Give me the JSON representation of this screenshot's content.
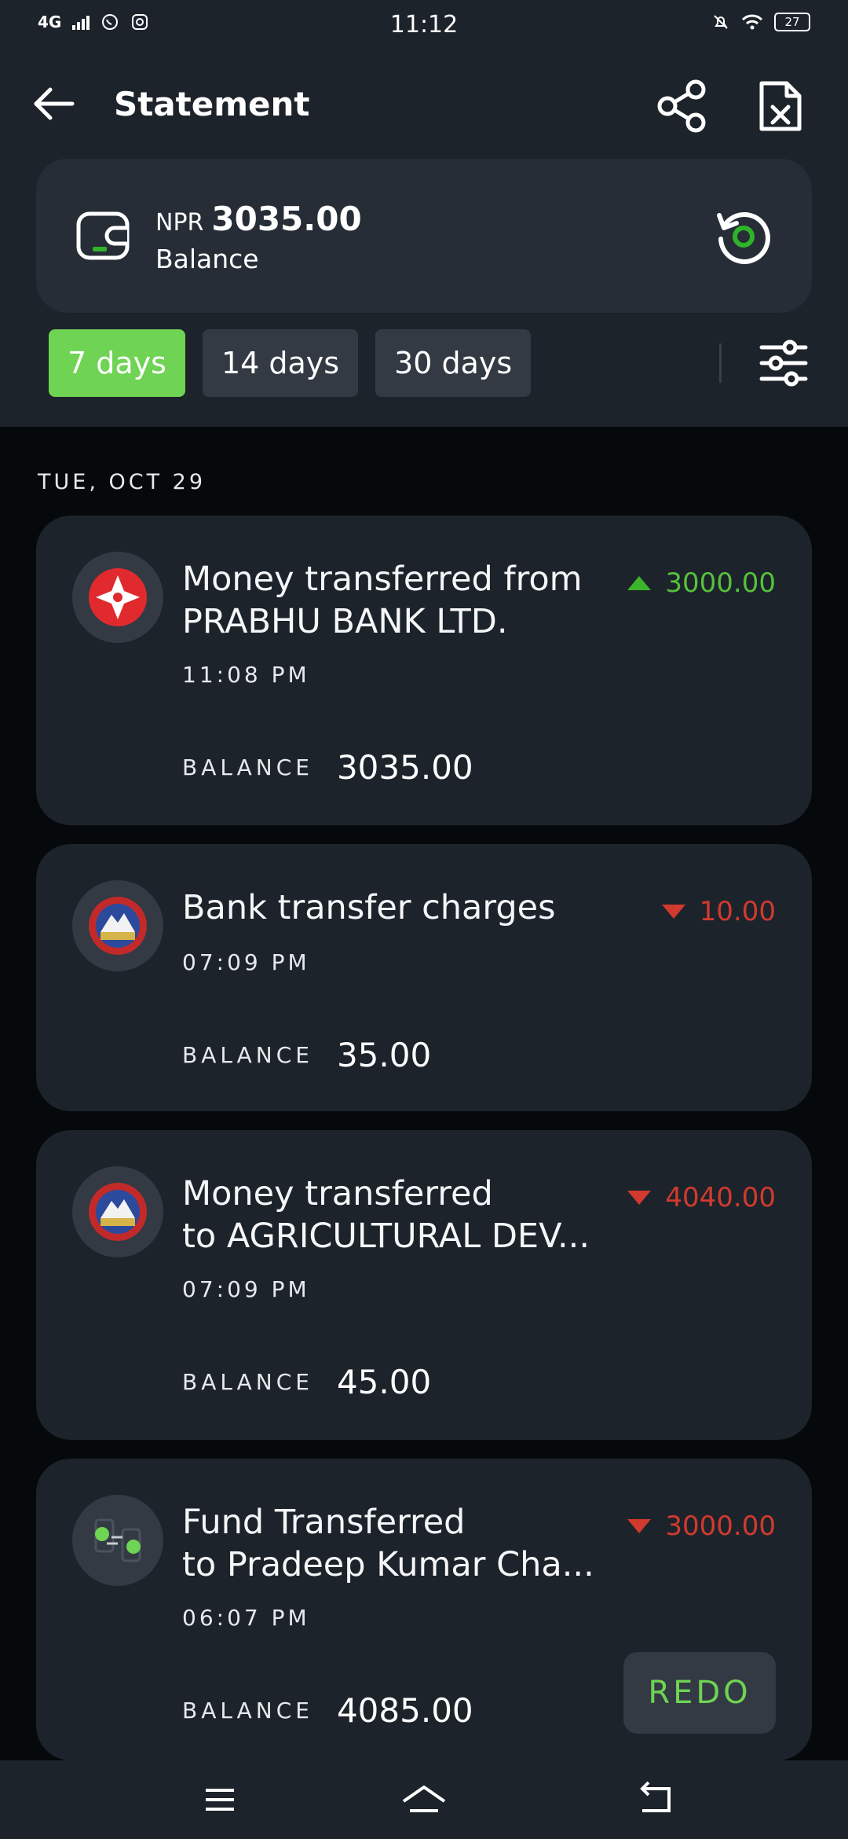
{
  "status_bar": {
    "network": "4G",
    "time": "11:12",
    "battery": "27"
  },
  "header": {
    "title": "Statement"
  },
  "balance": {
    "currency": "NPR",
    "amount": "3035.00",
    "label": "Balance"
  },
  "filters": [
    {
      "label": "7 days",
      "active": true
    },
    {
      "label": "14 days",
      "active": false
    },
    {
      "label": "30 days",
      "active": false
    }
  ],
  "date_header": "TUE, OCT 29",
  "transactions": [
    {
      "description_line1": "Money transferred from",
      "description_line2": "PRABHU BANK LTD.",
      "amount": "3000.00",
      "direction": "credit",
      "time": "11:08 PM",
      "balance_label": "BALANCE",
      "balance": "3035.00",
      "icon": "prabhu-bank-logo-icon"
    },
    {
      "description_line1": "Bank transfer charges",
      "description_line2": "",
      "amount": "10.00",
      "direction": "debit",
      "time": "07:09 PM",
      "balance_label": "BALANCE",
      "balance": "35.00",
      "icon": "agricultural-bank-logo-icon"
    },
    {
      "description_line1": "Money transferred",
      "description_line2": "to AGRICULTURAL DEV...",
      "amount": "4040.00",
      "direction": "debit",
      "time": "07:09 PM",
      "balance_label": "BALANCE",
      "balance": "45.00",
      "icon": "agricultural-bank-logo-icon"
    },
    {
      "description_line1": "Fund Transferred",
      "description_line2": "to Pradeep Kumar Cha...",
      "amount": "3000.00",
      "direction": "debit",
      "time": "06:07 PM",
      "balance_label": "BALANCE",
      "balance": "4085.00",
      "icon": "fund-transfer-icon",
      "action_label": "REDO"
    }
  ],
  "colors": {
    "accent": "#6fd353",
    "credit": "#55c13a",
    "debit": "#d13a2e",
    "card": "#1d232b",
    "background": "#05090c"
  }
}
